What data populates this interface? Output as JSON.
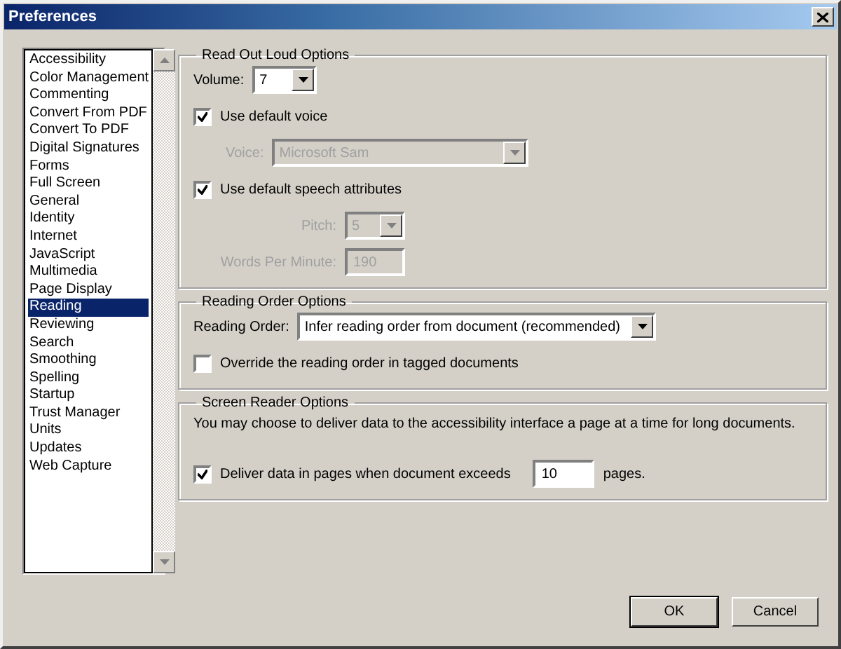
{
  "window": {
    "title": "Preferences"
  },
  "categories": [
    {
      "label": "Accessibility",
      "selected": false
    },
    {
      "label": "Color Management",
      "selected": false
    },
    {
      "label": "Commenting",
      "selected": false
    },
    {
      "label": "Convert From PDF",
      "selected": false
    },
    {
      "label": "Convert To PDF",
      "selected": false
    },
    {
      "label": "Digital Signatures",
      "selected": false
    },
    {
      "label": "Forms",
      "selected": false
    },
    {
      "label": "Full Screen",
      "selected": false
    },
    {
      "label": "General",
      "selected": false
    },
    {
      "label": "Identity",
      "selected": false
    },
    {
      "label": "Internet",
      "selected": false
    },
    {
      "label": "JavaScript",
      "selected": false
    },
    {
      "label": "Multimedia",
      "selected": false
    },
    {
      "label": "Page Display",
      "selected": false
    },
    {
      "label": "Reading",
      "selected": true
    },
    {
      "label": "Reviewing",
      "selected": false
    },
    {
      "label": "Search",
      "selected": false
    },
    {
      "label": "Smoothing",
      "selected": false
    },
    {
      "label": "Spelling",
      "selected": false
    },
    {
      "label": "Startup",
      "selected": false
    },
    {
      "label": "Trust Manager",
      "selected": false
    },
    {
      "label": "Units",
      "selected": false
    },
    {
      "label": "Updates",
      "selected": false
    },
    {
      "label": "Web Capture",
      "selected": false
    }
  ],
  "read_out_loud": {
    "title": "Read Out Loud Options",
    "volume": {
      "label": "Volume:",
      "value": "7",
      "disabled": false
    },
    "use_default_voice": {
      "label": "Use default voice",
      "checked": true
    },
    "voice": {
      "label": "Voice:",
      "value": "Microsoft Sam",
      "disabled": true
    },
    "use_default_speech": {
      "label": "Use default speech attributes",
      "checked": true
    },
    "pitch": {
      "label": "Pitch:",
      "value": "5",
      "disabled": true
    },
    "words_per_minute": {
      "label": "Words Per Minute:",
      "value": "190",
      "disabled": true
    }
  },
  "reading_order": {
    "title": "Reading Order Options",
    "order": {
      "label": "Reading Order:",
      "value": "Infer reading order from document (recommended)",
      "disabled": false
    },
    "override": {
      "label": "Override the reading order in tagged documents",
      "checked": false
    }
  },
  "screen_reader": {
    "title": "Screen Reader Options",
    "description": "You may choose to deliver data to the accessibility interface a page at a time for long documents.",
    "deliver": {
      "label": "Deliver data in pages when document exceeds",
      "checked": true
    },
    "pages": {
      "value": "10",
      "suffix": "pages."
    }
  },
  "buttons": [
    {
      "label": "OK",
      "default": true
    },
    {
      "label": "Cancel",
      "default": false
    }
  ]
}
